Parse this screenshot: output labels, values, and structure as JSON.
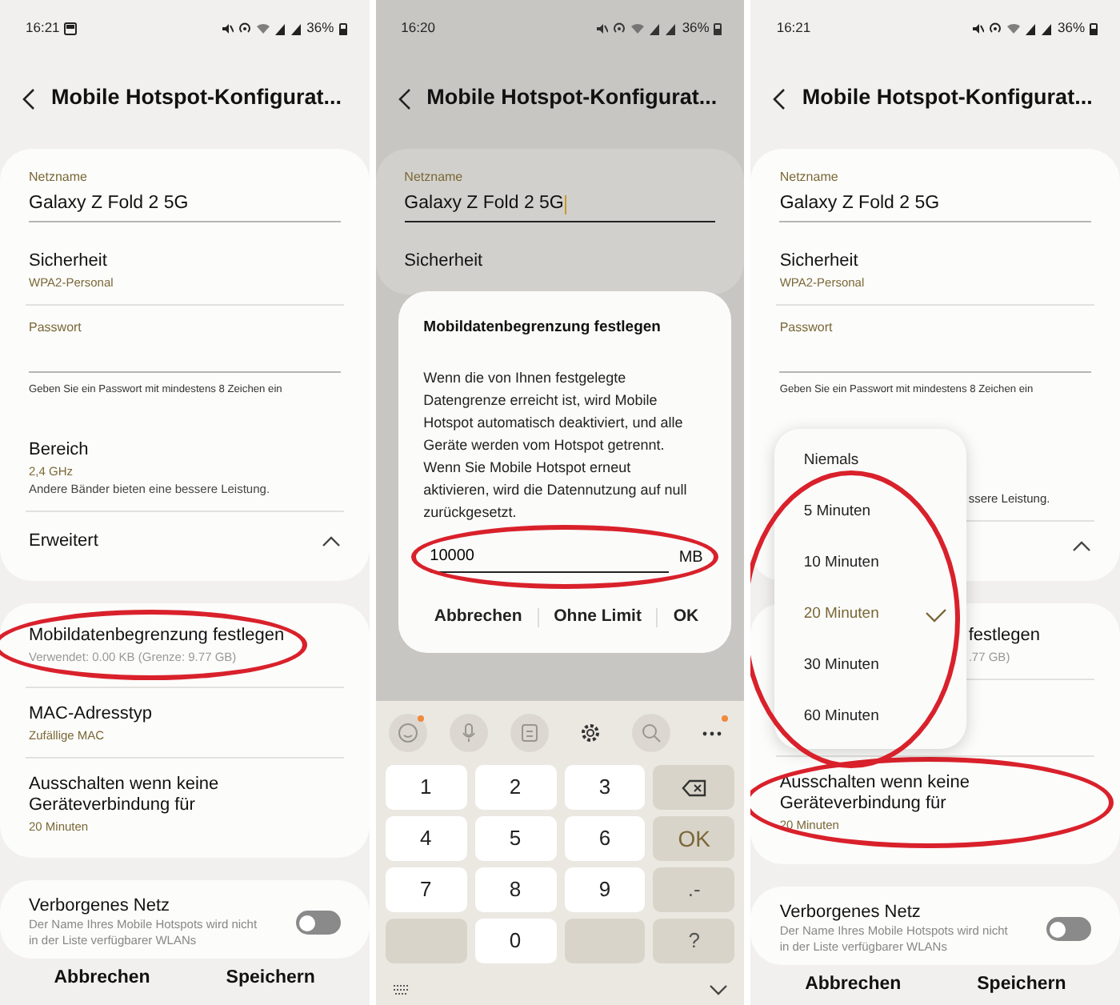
{
  "panels": [
    {
      "dimmed": false,
      "status_bar": {
        "time": "16:21",
        "notification_icon": true,
        "battery": "36%"
      },
      "title": "Mobile Hotspot-Konfigurat...",
      "cards": [
        {
          "items": [
            {
              "kind": "field",
              "label": "Netzname",
              "value": "Galaxy Z Fold 2 5G",
              "focused": false
            },
            {
              "kind": "setting",
              "title": "Sicherheit",
              "subtitle": "WPA2-Personal",
              "accent": true
            },
            {
              "kind": "field",
              "label": "Passwort",
              "focused": false
            },
            {
              "kind": "helper",
              "text": "Geben Sie ein Passwort mit mindestens 8 Zeichen ein"
            },
            {
              "kind": "setting",
              "title": "Bereich",
              "subtitle": "2,4 GHz",
              "accent": true,
              "note": "Andere Bänder bieten eine bessere Leistung."
            },
            {
              "kind": "expander",
              "title": "Erweitert",
              "expanded": true
            }
          ]
        },
        {
          "items": [
            {
              "kind": "setting",
              "title": "Mobildatenbegrenzung festlegen",
              "subtitle": "Verwendet: 0.00 KB (Grenze: 9.77 GB)",
              "accent": false,
              "circled": true
            },
            {
              "kind": "setting",
              "title": "MAC-Adresstyp",
              "subtitle": "Zufällige MAC",
              "accent": true
            },
            {
              "kind": "setting",
              "title": "Ausschalten wenn keine Geräteverbindung für",
              "subtitle": "20 Minuten",
              "accent": true
            }
          ]
        },
        {
          "items": [
            {
              "kind": "toggle",
              "title": "Verborgenes Netz",
              "description": "Der Name Ihres Mobile Hotspots wird nicht in der Liste verfügbarer WLANs",
              "on": false
            }
          ]
        }
      ],
      "bottom_buttons": [
        "Abbrechen",
        "Speichern"
      ]
    },
    {
      "dimmed": true,
      "status_bar": {
        "time": "16:20",
        "notification_icon": false,
        "battery": "36%"
      },
      "title": "Mobile Hotspot-Konfigurat...",
      "cards": [
        {
          "items": [
            {
              "kind": "field",
              "label": "Netzname",
              "value": "Galaxy Z Fold 2 5G",
              "focused": true
            },
            {
              "kind": "setting",
              "title": "Sicherheit"
            }
          ]
        }
      ],
      "dialog": {
        "title": "Mobildatenbegrenzung festlegen",
        "message": "Wenn die von Ihnen festgelegte Datengrenze erreicht ist, wird Mobile Hotspot automatisch deaktiviert, und alle Geräte werden vom Hotspot getrennt. Wenn Sie Mobile Hotspot erneut aktivieren, wird die Datennutzung auf null zurückgesetzt.",
        "input": {
          "value": "10000",
          "unit": "MB",
          "circled": true
        },
        "buttons": [
          "Abbrechen",
          "Ohne Limit",
          "OK"
        ]
      },
      "keyboard": {
        "toolbar": [
          {
            "kind": "emoji",
            "disabled": true,
            "badge": true
          },
          {
            "kind": "mic",
            "disabled": true,
            "badge": false
          },
          {
            "kind": "clipboard",
            "disabled": true,
            "badge": false
          },
          {
            "kind": "settings",
            "disabled": false,
            "badge": false
          },
          {
            "kind": "search",
            "disabled": true,
            "badge": false
          },
          {
            "kind": "more",
            "disabled": false,
            "badge": true
          }
        ],
        "keys": [
          {
            "kind": "digit",
            "label": "1"
          },
          {
            "kind": "digit",
            "label": "2"
          },
          {
            "kind": "digit",
            "label": "3"
          },
          {
            "kind": "backspace"
          },
          {
            "kind": "digit",
            "label": "4"
          },
          {
            "kind": "digit",
            "label": "5"
          },
          {
            "kind": "digit",
            "label": "6"
          },
          {
            "kind": "action",
            "label": "OK"
          },
          {
            "kind": "digit",
            "label": "7"
          },
          {
            "kind": "digit",
            "label": "8"
          },
          {
            "kind": "digit",
            "label": "9"
          },
          {
            "kind": "function",
            "label": ".-"
          },
          {
            "kind": "blank"
          },
          {
            "kind": "digit",
            "label": "0"
          },
          {
            "kind": "blank"
          },
          {
            "kind": "function",
            "label": "?"
          }
        ]
      }
    },
    {
      "dimmed": false,
      "status_bar": {
        "time": "16:21",
        "notification_icon": false,
        "battery": "36%"
      },
      "title": "Mobile Hotspot-Konfigurat...",
      "cards": [
        {
          "items": [
            {
              "kind": "field",
              "label": "Netzname",
              "value": "Galaxy Z Fold 2 5G",
              "focused": false
            },
            {
              "kind": "setting",
              "title": "Sicherheit",
              "subtitle": "WPA2-Personal",
              "accent": true
            },
            {
              "kind": "field",
              "label": "Passwort",
              "focused": false
            },
            {
              "kind": "helper",
              "text": "Geben Sie ein Passwort mit mindestens 8 Zeichen ein"
            },
            {
              "kind": "partial",
              "note": "ssere Leistung."
            },
            {
              "kind": "expander",
              "expanded": true
            }
          ]
        },
        {
          "items": [
            {
              "kind": "partial",
              "title": "festlegen",
              "subtitle": ".77 GB)"
            },
            {
              "kind": "covered"
            },
            {
              "kind": "setting",
              "title": "Ausschalten wenn keine Geräteverbindung für",
              "subtitle": "20 Minuten",
              "accent": true,
              "circled": true
            }
          ]
        },
        {
          "items": [
            {
              "kind": "toggle",
              "title": "Verborgenes Netz",
              "description": "Der Name Ihres Mobile Hotspots wird nicht in der Liste verfügbarer WLANs",
              "on": false
            }
          ]
        }
      ],
      "menu": {
        "circled": true,
        "options": [
          {
            "label": "Niemals",
            "selected": false
          },
          {
            "label": "5 Minuten",
            "selected": false
          },
          {
            "label": "10 Minuten",
            "selected": false
          },
          {
            "label": "20 Minuten",
            "selected": true
          },
          {
            "label": "30 Minuten",
            "selected": false
          },
          {
            "label": "60 Minuten",
            "selected": false
          }
        ]
      },
      "bottom_buttons": [
        "Abbrechen",
        "Speichern"
      ]
    }
  ]
}
